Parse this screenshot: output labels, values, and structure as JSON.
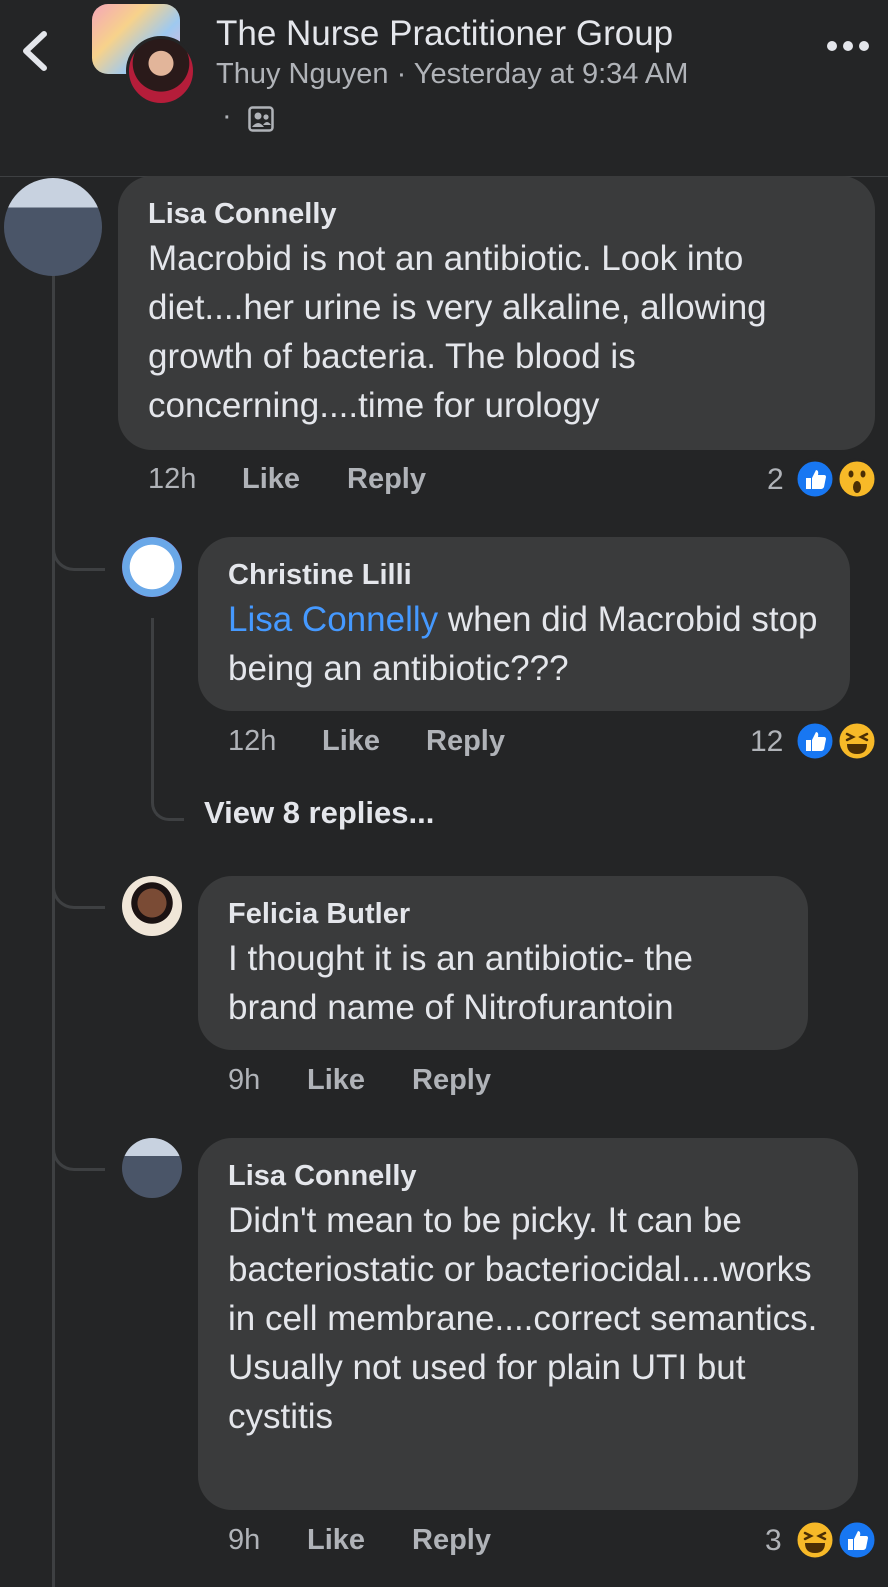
{
  "header": {
    "group_name": "The Nurse Practitioner Group",
    "poster": "Thuy Nguyen",
    "separator": "·",
    "timestamp": "Yesterday at 9:34 AM",
    "privacy_dot": "·",
    "icons": {
      "back": "chevron-left-icon",
      "more": "more-dots-icon",
      "audience": "members-icon"
    }
  },
  "comments": [
    {
      "author": "Lisa Connelly",
      "text": "Macrobid is not an antibiotic. Look into diet....her urine is very alkaline, allowing growth of bacteria. The blood is concerning....time for urology",
      "time": "12h",
      "like": "Like",
      "reply": "Reply",
      "reaction_count": "2",
      "reactions": [
        "like",
        "wow"
      ]
    },
    {
      "author": "Christine Lilli",
      "mention": "Lisa Connelly",
      "text": " when did Macrobid stop being an antibiotic???",
      "time": "12h",
      "like": "Like",
      "reply": "Reply",
      "reaction_count": "12",
      "reactions": [
        "like",
        "haha"
      ],
      "view_replies": "View 8 replies..."
    },
    {
      "author": "Felicia Butler",
      "text": "I thought it is an antibiotic- the brand name of Nitrofurantoin",
      "time": "9h",
      "like": "Like",
      "reply": "Reply"
    },
    {
      "author": "Lisa Connelly",
      "text": "Didn't mean to be picky. It can be bacteriostatic or bacteriocidal....works in cell membrane....correct semantics. Usually not used for plain UTI but cystitis",
      "time": "9h",
      "like": "Like",
      "reply": "Reply",
      "reaction_count": "3",
      "reactions": [
        "haha",
        "like"
      ]
    }
  ],
  "colors": {
    "background": "#242526",
    "bubble": "#3a3b3c",
    "mention": "#4599ff",
    "like_blue": "#1877f2",
    "emoji_yellow": "#f7b928"
  }
}
